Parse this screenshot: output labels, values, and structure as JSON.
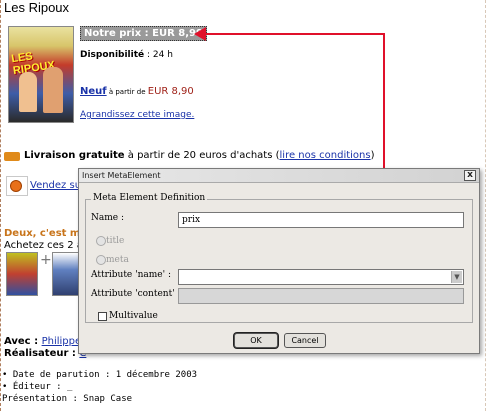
{
  "page": {
    "title": "Les Ripoux",
    "cover_title": "LES RIPOUX",
    "price_label": "Notre prix : EUR 8,99",
    "dispo_label": "Disponibilité",
    "dispo_sep": " : ",
    "dispo_value": "24 h",
    "neuf_link": "Neuf",
    "neuf_small": " à partir de ",
    "neuf_price": "EUR 8,90",
    "agrandir_link": "Agrandissez cette image.",
    "livraison_bold": "Livraison gratuite",
    "livraison_text": " à partir de 20 euros d'achats (",
    "livraison_link": "lire nos conditions",
    "livraison_end": ")",
    "sell_link": "Vendez su",
    "deux_title": "Deux, c'est mi",
    "achetez": "Achetez ces 2 a",
    "plus": "+",
    "avec_label": "Avec : ",
    "avec_link": "Philippe",
    "real_label": "Réalisateur : ",
    "real_link": "C",
    "bullets": [
      "• Date de parution : 1 décembre 2003",
      "• Éditeur : _",
      "Présentation : Snap Case"
    ]
  },
  "dialog": {
    "title": "Insert MetaElement",
    "close": "x",
    "legend": "Meta Element Definition",
    "name_label": "Name :",
    "name_value": "prix",
    "radio_title": "title",
    "radio_meta": "meta",
    "attr_name_label": "Attribute 'name' :",
    "attr_name_value": "",
    "attr_content_label": "Attribute 'content' :",
    "attr_content_value": "",
    "multivalue_label": "Multivalue",
    "ok_label": "OK",
    "cancel_label": "Cancel"
  },
  "colors": {
    "accent_arrow": "#e0102a",
    "link": "#1a33a8",
    "price": "#a0231a",
    "deux": "#c8741a"
  }
}
